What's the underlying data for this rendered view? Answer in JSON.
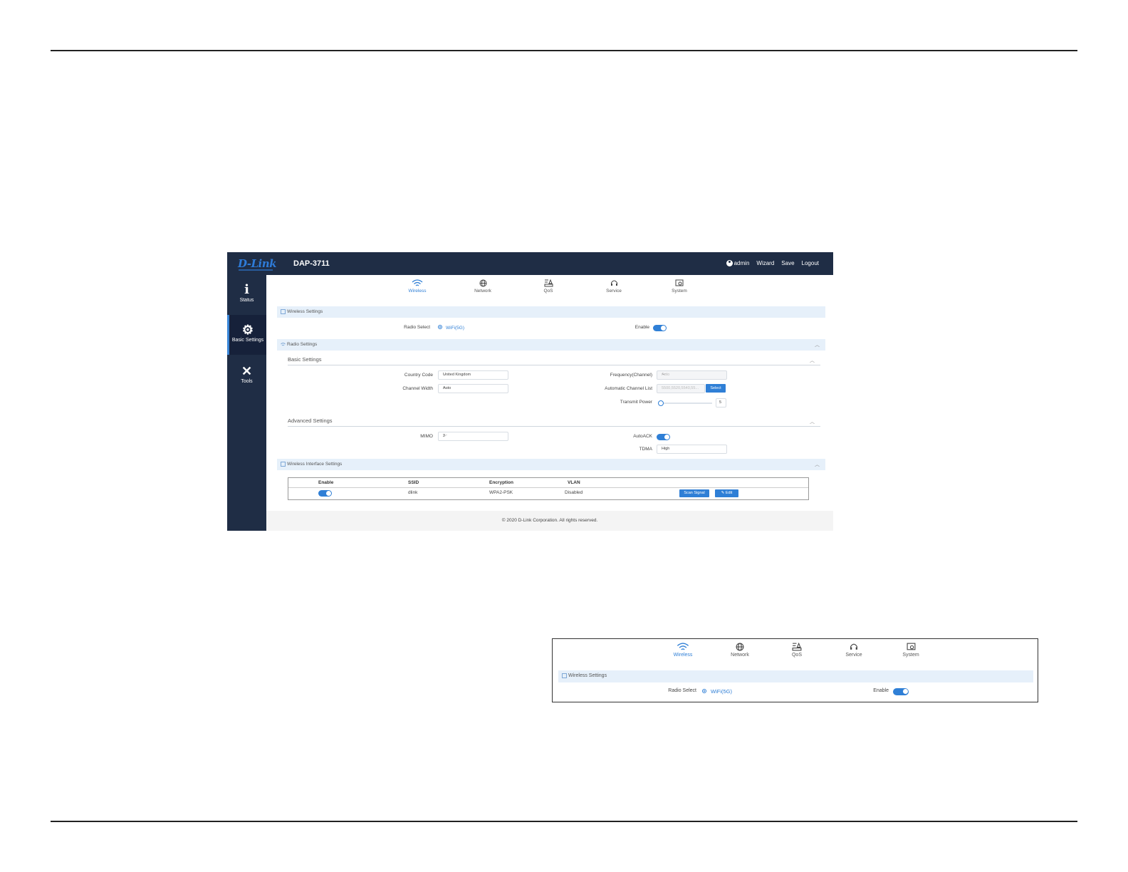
{
  "header": {
    "logo": "D-Link",
    "model": "DAP-3711",
    "user": "admin",
    "nav": [
      "Wizard",
      "Save",
      "Logout"
    ]
  },
  "sidebar": {
    "items": [
      {
        "label": "Status",
        "icon": "info-icon"
      },
      {
        "label": "Basic Settings",
        "icon": "gear-icon",
        "active": true
      },
      {
        "label": "Tools",
        "icon": "tools-icon"
      }
    ]
  },
  "tabs": [
    {
      "label": "Wireless",
      "icon": "wifi-icon",
      "active": true
    },
    {
      "label": "Network",
      "icon": "globe-icon"
    },
    {
      "label": "QoS",
      "icon": "qos-icon"
    },
    {
      "label": "Service",
      "icon": "headset-icon"
    },
    {
      "label": "System",
      "icon": "system-icon"
    }
  ],
  "wireless_settings": {
    "title": "Wireless Settings",
    "radio_select_label": "Radio Select",
    "radio_select_value": "WiFi(5G)",
    "enable_label": "Enable",
    "enabled": true
  },
  "radio_settings": {
    "title": "Radio Settings",
    "basic": {
      "title": "Basic Settings",
      "country_code_label": "Country Code",
      "country_code": "United Kingdom",
      "channel_width_label": "Channel Width",
      "channel_width": "Auto",
      "frequency_label": "Frequency(Channel)",
      "frequency": "Auto",
      "auto_channel_label": "Automatic Channel List",
      "auto_channel": "5500,5520,5540,55...",
      "select_button": "Select",
      "transmit_power_label": "Transmit Power",
      "transmit_power": "5"
    },
    "advanced": {
      "title": "Advanced Settings",
      "mimo_label": "MIMO",
      "mimo": "2",
      "autoack_label": "AutoACK",
      "autoack": true,
      "tdma_label": "TDMA",
      "tdma": "High"
    }
  },
  "interface_settings": {
    "title": "Wireless Interface Settings",
    "columns": [
      "Enable",
      "SSID",
      "Encryption",
      "VLAN"
    ],
    "rows": [
      {
        "enable": true,
        "ssid": "dlink",
        "encryption": "WPA2-PSK",
        "vlan": "Disabled"
      }
    ],
    "scan_button": "Scan Signal",
    "edit_button": "Edit"
  },
  "footer": "© 2020 D-Link Corporation. All rights reserved.",
  "colors": {
    "navy": "#1f2d45",
    "accent": "#2f7fd6",
    "section_bg": "#e6f0fa"
  }
}
